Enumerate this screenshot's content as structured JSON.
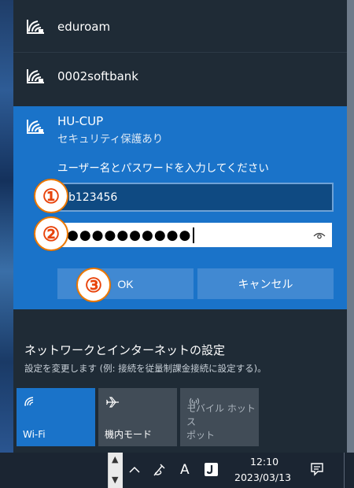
{
  "networks": [
    {
      "ssid": "eduroam"
    },
    {
      "ssid": "0002softbank"
    }
  ],
  "expanded": {
    "ssid": "HU-CUP",
    "security": "セキュリティ保護あり",
    "prompt": "ユーザー名とパスワードを入力してください",
    "username_value": "b123456",
    "password_mask": "●●●●●●●●●●",
    "ok_label": "OK",
    "cancel_label": "キャンセル"
  },
  "annotations": [
    "①",
    "②",
    "③"
  ],
  "settings": {
    "title": "ネットワークとインターネットの設定",
    "description": "設定を変更します (例: 接続を従量制課金接続に設定する)。"
  },
  "tiles": [
    {
      "label": "Wi-Fi",
      "icon": "wifi-icon",
      "active": true
    },
    {
      "label": "機内モード",
      "icon": "airplane-icon",
      "active": false
    },
    {
      "label": "モバイル ホットスポット",
      "label_line1": "モバイル ホットス",
      "label_line2": "ポット",
      "icon": "hotspot-icon",
      "active": false
    }
  ],
  "taskbar": {
    "time": "12:10",
    "date": "2023/03/13",
    "ime_label": "A",
    "up_arrow": "^",
    "scroll_up": "^",
    "scroll_down": "v"
  },
  "colors": {
    "flyout_bg": "#1f2b36",
    "accent": "#1a73c9",
    "button": "#4189d2",
    "badge_text": "#e8430b",
    "badge_border": "#ee7800"
  }
}
